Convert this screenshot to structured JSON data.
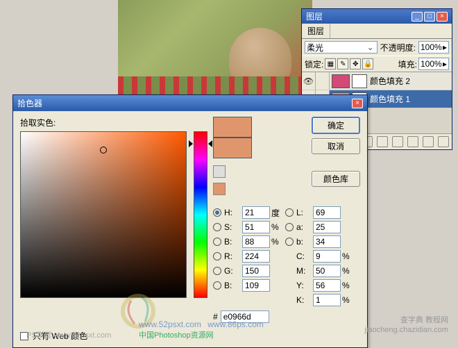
{
  "layersPalette": {
    "title": "图层",
    "blend": {
      "label": "柔光"
    },
    "opacity": {
      "label": "不透明度:",
      "value": "100%"
    },
    "lock": {
      "label": "锁定:",
      "fill_label": "填充:",
      "fill_value": "100%"
    },
    "layers": [
      {
        "name": "颜色填充 2",
        "swatch": "#d34a76",
        "selected": false
      },
      {
        "name": "颜色填充 1",
        "swatch": "#e0966d",
        "selected": true
      }
    ]
  },
  "picker": {
    "title": "拾色器",
    "field_label": "拾取实色:",
    "buttons": {
      "ok": "确定",
      "cancel": "取消",
      "libs": "颜色库"
    },
    "hsb": {
      "H": {
        "label": "H:",
        "value": "21",
        "unit": "度"
      },
      "S": {
        "label": "S:",
        "value": "51",
        "unit": "%"
      },
      "B": {
        "label": "B:",
        "value": "88",
        "unit": "%"
      }
    },
    "lab": {
      "L": {
        "label": "L:",
        "value": "69",
        "unit": ""
      },
      "a": {
        "label": "a:",
        "value": "25",
        "unit": ""
      },
      "b": {
        "label": "b:",
        "value": "34",
        "unit": ""
      }
    },
    "rgb": {
      "R": {
        "label": "R:",
        "value": "224"
      },
      "G": {
        "label": "G:",
        "value": "150"
      },
      "B": {
        "label": "B:",
        "value": "109"
      }
    },
    "cmyk": {
      "C": {
        "label": "C:",
        "value": "9",
        "unit": "%"
      },
      "M": {
        "label": "M:",
        "value": "50",
        "unit": "%"
      },
      "Y": {
        "label": "Y:",
        "value": "56",
        "unit": "%"
      },
      "K": {
        "label": "K:",
        "value": "1",
        "unit": "%"
      }
    },
    "hex": {
      "label": "#",
      "value": "e0966d"
    },
    "web_only": "只有 Web 颜色"
  },
  "watermarks": {
    "site1": "www.52psxt.com",
    "site2": "PS学堂  www.52psxt.com",
    "site3": "查字典 教程网\njiaocheng.chazidian.com",
    "site4": "中国Photoshop资源网",
    "site5": "www.86ps.com"
  }
}
